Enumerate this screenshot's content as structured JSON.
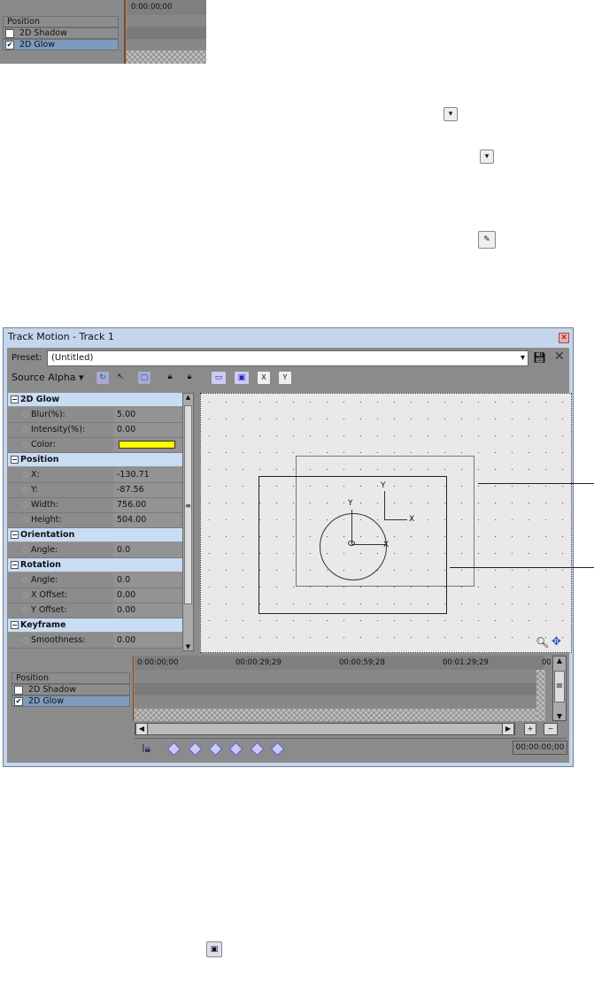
{
  "top_snippet": {
    "time": "0:00:00;00",
    "header": "Position",
    "rows": [
      {
        "label": "2D Shadow",
        "checked": false
      },
      {
        "label": "2D Glow",
        "checked": true
      }
    ]
  },
  "icons": [
    "dropdown-icon",
    "dropdown-icon",
    "eyedropper-icon",
    "window-icon"
  ],
  "dialog": {
    "title": "Track Motion - Track 1",
    "preset_label": "Preset:",
    "preset_value": "(Untitled)",
    "source_label": "Source Alpha",
    "sections": [
      {
        "title": "2D Glow",
        "props": [
          {
            "k": "Blur(%):",
            "v": "5.00"
          },
          {
            "k": "Intensity(%):",
            "v": "0.00"
          },
          {
            "k": "Color:",
            "v": "",
            "color": "#ffff00"
          }
        ]
      },
      {
        "title": "Position",
        "props": [
          {
            "k": "X:",
            "v": "-130.71"
          },
          {
            "k": "Y:",
            "v": "-87.56"
          },
          {
            "k": "Width:",
            "v": "756.00"
          },
          {
            "k": "Height:",
            "v": "504.00"
          }
        ]
      },
      {
        "title": "Orientation",
        "props": [
          {
            "k": "Angle:",
            "v": "0.0"
          }
        ]
      },
      {
        "title": "Rotation",
        "props": [
          {
            "k": "Angle:",
            "v": "0.0"
          },
          {
            "k": "X Offset:",
            "v": "0.00"
          },
          {
            "k": "Y Offset:",
            "v": "0.00"
          }
        ]
      },
      {
        "title": "Keyframe",
        "props": [
          {
            "k": "Smoothness:",
            "v": "0.00"
          }
        ]
      }
    ],
    "axes": {
      "x": "X",
      "y": "Y"
    },
    "timeline": {
      "header": "Position",
      "rows": [
        {
          "label": "2D Shadow",
          "checked": false
        },
        {
          "label": "2D Glow",
          "checked": true
        }
      ],
      "ticks": [
        "0:00:00;00",
        "00:00:29;29",
        "00:00:59;28",
        "00:01:29;29",
        "00:"
      ],
      "time": "00:00:00;00"
    }
  }
}
